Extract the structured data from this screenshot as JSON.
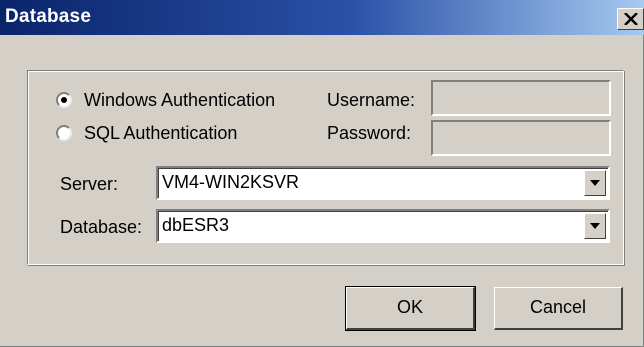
{
  "window": {
    "title": "Database",
    "close_icon": "close-x-icon"
  },
  "auth": {
    "windows_label": "Windows Authentication",
    "sql_label": "SQL Authentication",
    "selected": "windows"
  },
  "credentials": {
    "username_label": "Username:",
    "username_value": "",
    "password_label": "Password:",
    "password_value": ""
  },
  "server": {
    "label": "Server:",
    "value": "VM4-WIN2KSVR"
  },
  "database": {
    "label": "Database:",
    "value": "dbESR3"
  },
  "buttons": {
    "ok": "OK",
    "cancel": "Cancel"
  }
}
